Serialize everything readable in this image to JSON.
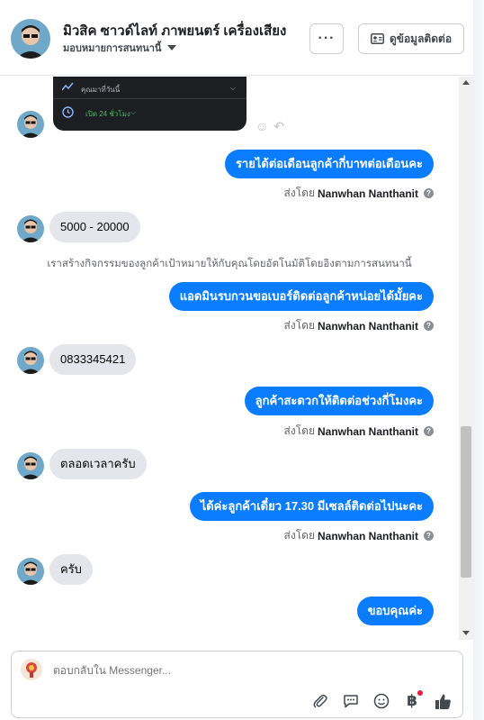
{
  "header": {
    "page_name": "มิวสิค ซาวด์ไลท์ ภาพยนตร์ เครื่องเสียง",
    "assign_label": "มอบหมายการสนทนานี้",
    "more_label": "···",
    "contact_label": "ดูข้อมูลติดต่อ"
  },
  "card": {
    "row1_label": "คุณมาที่วันนี้",
    "row2_label": "เปิด 24 ชั่วโมง"
  },
  "messages": [
    {
      "dir": "out",
      "text": "รายได้ต่อเดือนลูกค้ากี่บาทต่อเดือนคะ"
    },
    {
      "dir": "in",
      "text": "5000 - 20000"
    },
    {
      "dir": "out",
      "text": "แอดมินรบกวนขอเบอร์ติดต่อลูกค้าหน่อยได้มั้ยคะ"
    },
    {
      "dir": "in",
      "text": "0833345421"
    },
    {
      "dir": "out",
      "text": "ลูกค้าสะดวกให้ติดต่อช่วงกี่โมงคะ"
    },
    {
      "dir": "in",
      "text": "ตลอดเวลาครับ"
    },
    {
      "dir": "out",
      "text": "ได้ค่ะลูกค้าเดี๋ยว 17.30 มีเซลล์ติดต่อไปนะคะ"
    },
    {
      "dir": "in",
      "text": "ครับ"
    },
    {
      "dir": "out",
      "text": "ขอบคุณค่ะ"
    }
  ],
  "sent_by": {
    "prefix": "ส่งโดย",
    "name": "Nanwhan Nanthanit"
  },
  "system_note": "เราสร้างกิจกรรมของลูกค้าเป้าหมายให้กับคุณโดยอัตโนมัติโดยอิงตามการสนทนานี้",
  "composer": {
    "placeholder": "ตอบกลับใน Messenger..."
  },
  "colors": {
    "outgoing_bubble": "#0a7cff",
    "incoming_bubble": "#e4e6eb",
    "notification_dot": "#e41e3f"
  }
}
